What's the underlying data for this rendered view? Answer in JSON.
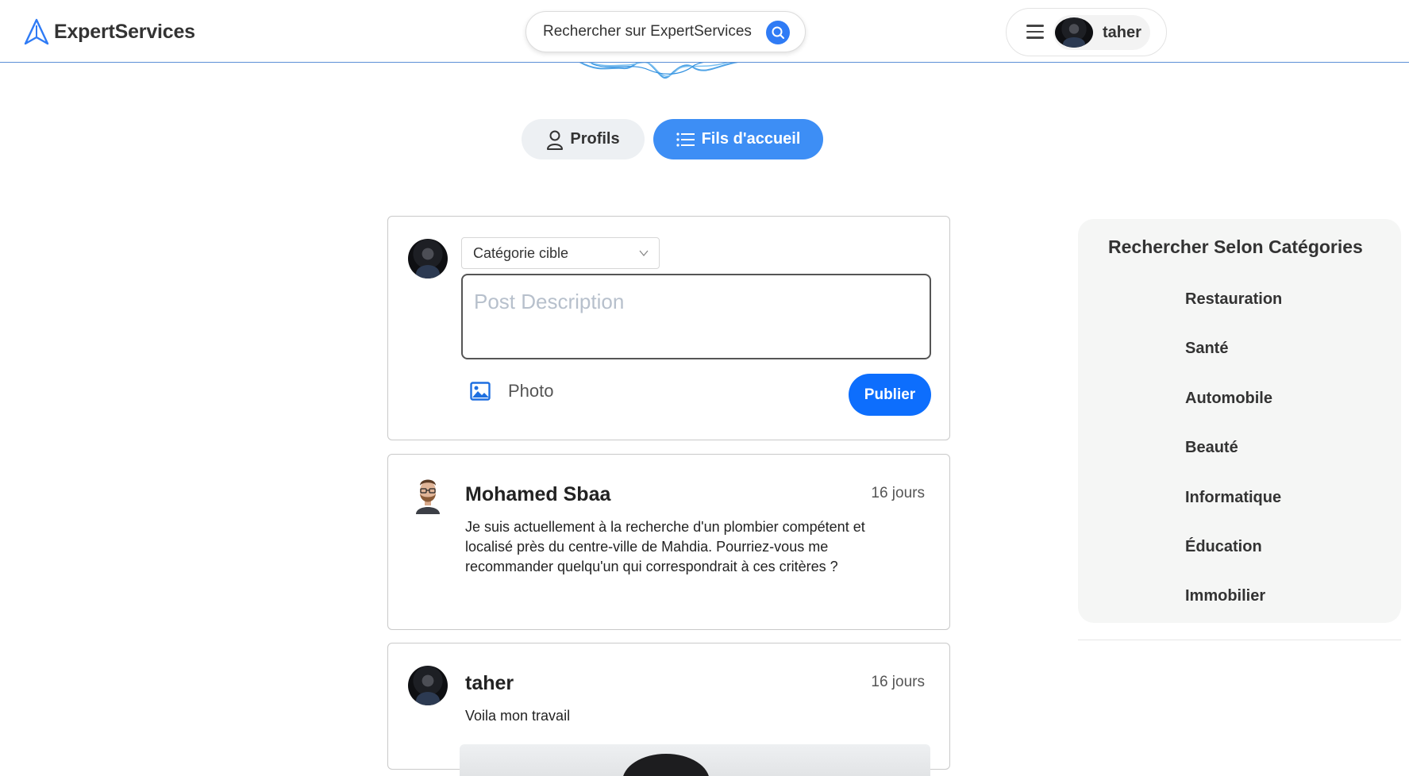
{
  "header": {
    "brand": "ExpertServices",
    "search_placeholder": "Rechercher sur ExpertServices",
    "username": "taher"
  },
  "tabs": [
    {
      "label": "Profils",
      "active": false
    },
    {
      "label": "Fils d'accueil",
      "active": true
    }
  ],
  "composer": {
    "category_select": "Catégorie cible",
    "description_placeholder": "Post Description",
    "photo_label": "Photo",
    "publish_label": "Publier"
  },
  "posts": [
    {
      "author": "Mohamed Sbaa",
      "time": "16 jours",
      "body": "Je suis actuellement à la recherche d'un plombier compétent et localisé près du centre-ville de Mahdia. Pourriez-vous me recommander quelqu'un qui correspondrait à ces critères ?"
    },
    {
      "author": "taher",
      "time": "16 jours",
      "body": "Voila mon travail"
    }
  ],
  "sidebar": {
    "title": "Rechercher Selon Catégories",
    "categories": [
      "Restauration",
      "Santé",
      "Automobile",
      "Beauté",
      "Informatique",
      "Éducation",
      "Immobilier"
    ]
  },
  "colors": {
    "accent": "#3d8ef5",
    "publish": "#0d6efd",
    "header_border": "#5b8fd6"
  }
}
